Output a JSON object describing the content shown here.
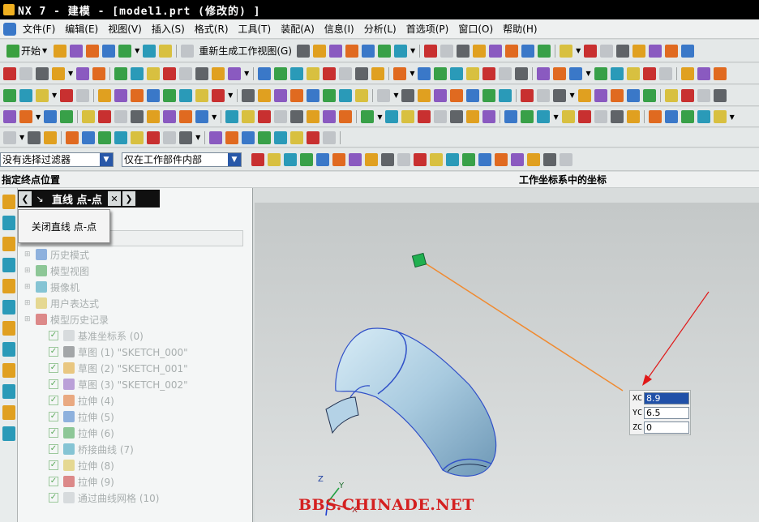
{
  "window": {
    "title": "NX 7 - 建模 - [model1.prt  (修改的) ]"
  },
  "menu": [
    "文件(F)",
    "编辑(E)",
    "视图(V)",
    "插入(S)",
    "格式(R)",
    "工具(T)",
    "装配(A)",
    "信息(I)",
    "分析(L)",
    "首选项(P)",
    "窗口(O)",
    "帮助(H)"
  ],
  "toolbar": {
    "start_label": "开始",
    "regen_label": "重新生成工作视图(G)"
  },
  "filter": {
    "type_value": "没有选择过滤器",
    "scope_value": "仅在工作部件内部"
  },
  "status": {
    "prompt": "指定终点位置",
    "right": "工作坐标系中的坐标"
  },
  "dialog": {
    "title": "直线 点-点",
    "tooltip": "关闭直线 点-点"
  },
  "tree": {
    "items": [
      {
        "label": "历史模式",
        "level": 1
      },
      {
        "label": "模型视图",
        "level": 1
      },
      {
        "label": "摄像机",
        "level": 1
      },
      {
        "label": "用户表达式",
        "level": 1
      },
      {
        "label": "模型历史记录",
        "level": 1
      },
      {
        "label": "基准坐标系 (0)",
        "level": 2
      },
      {
        "label": "草图 (1) \"SKETCH_000\"",
        "level": 2
      },
      {
        "label": "草图 (2) \"SKETCH_001\"",
        "level": 2
      },
      {
        "label": "草图 (3) \"SKETCH_002\"",
        "level": 2
      },
      {
        "label": "拉伸 (4)",
        "level": 2
      },
      {
        "label": "拉伸 (5)",
        "level": 2
      },
      {
        "label": "拉伸 (6)",
        "level": 2
      },
      {
        "label": "桥接曲线 (7)",
        "level": 2
      },
      {
        "label": "拉伸 (8)",
        "level": 2
      },
      {
        "label": "拉伸 (9)",
        "level": 2
      },
      {
        "label": "通过曲线网格 (10)",
        "level": 2
      }
    ]
  },
  "coords": {
    "xc_label": "XC",
    "xc": "8.9",
    "yc_label": "YC",
    "yc": "6.5",
    "zc_label": "ZC",
    "zc": "0"
  },
  "triad": {
    "y": "Y",
    "x": "X",
    "z": "Z"
  },
  "watermark": "BBS.CHINADE.NET",
  "colors": {
    "accent": "#2050a8",
    "rubberband": "#f08a30",
    "arrow": "#e01818",
    "model": "#b4d2e6",
    "edge": "#3050c8",
    "endpoint": "#20b050",
    "watermark": "#d42020"
  }
}
